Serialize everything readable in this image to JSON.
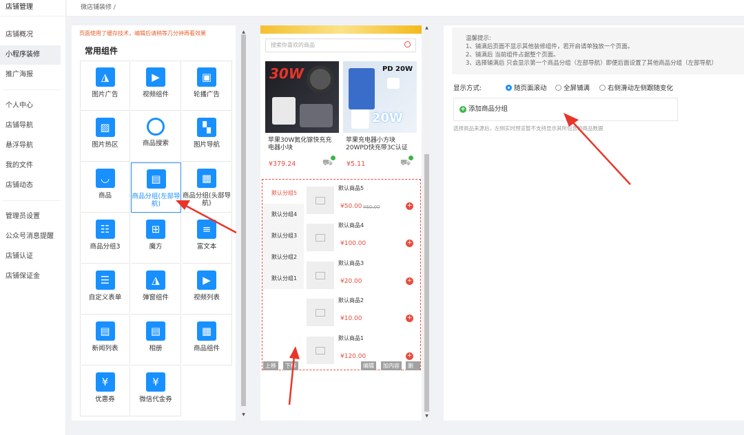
{
  "nav": {
    "brand": "店铺管理",
    "items": [
      {
        "label": "店铺概况"
      },
      {
        "label": "小程序装修"
      },
      {
        "label": "推广海报"
      },
      {
        "label": "个人中心"
      },
      {
        "label": "店铺导航"
      },
      {
        "label": "悬浮导航"
      },
      {
        "label": "我的文件"
      },
      {
        "label": "店铺动态"
      },
      {
        "label": "管理员设置"
      },
      {
        "label": "公众号消息提醒"
      },
      {
        "label": "店铺认证"
      },
      {
        "label": "店铺保证金"
      }
    ]
  },
  "breadcrumb": "微店铺装修 /",
  "components": {
    "cache_note": "页面使用了缓存技术，编辑后请稍等几分钟再看效果",
    "section_title": "常用组件",
    "items": [
      {
        "label": "图片广告",
        "icon": "image-icon"
      },
      {
        "label": "视频组件",
        "icon": "video-icon"
      },
      {
        "label": "轮播广告",
        "icon": "carousel-icon"
      },
      {
        "label": "图片热区",
        "icon": "hotspot-icon"
      },
      {
        "label": "商品搜索",
        "icon": "search-icon"
      },
      {
        "label": "图片导航",
        "icon": "image-nav-icon"
      },
      {
        "label": "商品",
        "icon": "product-icon"
      },
      {
        "label": "商品分组(左部导航)",
        "icon": "group-left-icon"
      },
      {
        "label": "商品分组(头部导航)",
        "icon": "group-top-icon"
      },
      {
        "label": "商品分组3",
        "icon": "group3-icon"
      },
      {
        "label": "魔方",
        "icon": "cube-icon"
      },
      {
        "label": "富文本",
        "icon": "richtext-icon"
      },
      {
        "label": "自定义表单",
        "icon": "form-icon"
      },
      {
        "label": "弹窗组件",
        "icon": "popup-icon"
      },
      {
        "label": "视频列表",
        "icon": "video-list-icon"
      },
      {
        "label": "新闻列表",
        "icon": "news-icon"
      },
      {
        "label": "相册",
        "icon": "album-icon"
      },
      {
        "label": "商品组件",
        "icon": "product-component-icon"
      },
      {
        "label": "优惠券",
        "icon": "coupon-icon"
      },
      {
        "label": "微信代金券",
        "icon": "wechat-voucher-icon"
      }
    ]
  },
  "preview": {
    "search_placeholder": "搜索你喜欢的商品",
    "products": [
      {
        "title": "苹果30W氮化镓快充充电器小块",
        "price": "¥379.24",
        "badge": "30W"
      },
      {
        "title": "苹果充电器小方块20WPD快充带3C认证",
        "price": "¥5.11",
        "badge": "PD 20W",
        "badge2": "20W"
      }
    ],
    "group_widget": {
      "categories": [
        "默认分组5",
        "默认分组4",
        "默认分组3",
        "默认分组2",
        "默认分组1"
      ],
      "items": [
        {
          "name": "默认商品5",
          "price": "¥50.00",
          "old_price": "¥60.00"
        },
        {
          "name": "默认商品4",
          "price": "¥100.00"
        },
        {
          "name": "默认商品3",
          "price": "¥20.00"
        },
        {
          "name": "默认商品2",
          "price": "¥10.00"
        },
        {
          "name": "默认商品1",
          "price": "¥120.00"
        }
      ],
      "controls": {
        "up": "上移",
        "down": "下移",
        "edit": "编辑",
        "add_content": "加内容",
        "delete": "删除"
      }
    }
  },
  "settings": {
    "tips": [
      "温馨提示:",
      "1、铺满后页面不显示其他装修组件，若开启请单独放一个页面。",
      "2、铺满后 当前组件占据整个页面。",
      "3、选择铺满后 只会显示第一个商品分组（左部导航）即便后面设置了其他商品分组（左部导航）"
    ],
    "display_mode_label": "显示方式:",
    "modes": [
      {
        "label": "随页面滚动",
        "checked": true
      },
      {
        "label": "全屏铺满",
        "checked": false
      },
      {
        "label": "右侧滑动左侧跟随变化",
        "checked": false
      }
    ],
    "add_group_label": "添加商品分组",
    "source_note": "选择商品来源后，左侧实时预览暂不支持显示其所包含的商品数据"
  },
  "colors": {
    "accent": "#1890ff",
    "price": "#e84c3d",
    "annotation": "#e8352a"
  }
}
